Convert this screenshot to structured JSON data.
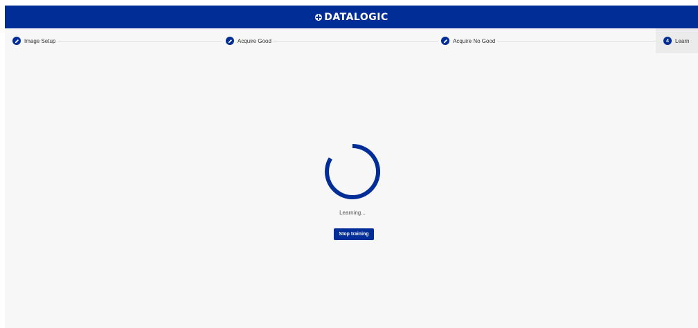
{
  "header": {
    "brand": "DATALOGIC",
    "brand_icon": "datalogic-logo-icon",
    "background_color": "#002e96"
  },
  "stepper": {
    "steps": [
      {
        "label": "Image Setup",
        "icon": "pencil-icon",
        "state": "completed"
      },
      {
        "label": "Acquire Good",
        "icon": "pencil-icon",
        "state": "completed"
      },
      {
        "label": "Acquire No Good",
        "icon": "pencil-icon",
        "state": "completed"
      },
      {
        "label": "Learn",
        "number": "4",
        "state": "active"
      }
    ]
  },
  "main": {
    "spinner_icon": "loading-spinner-icon",
    "status_text": "Learning...",
    "stop_button_label": "Stop training"
  },
  "colors": {
    "accent": "#002e96",
    "background": "#f7f7f7"
  }
}
